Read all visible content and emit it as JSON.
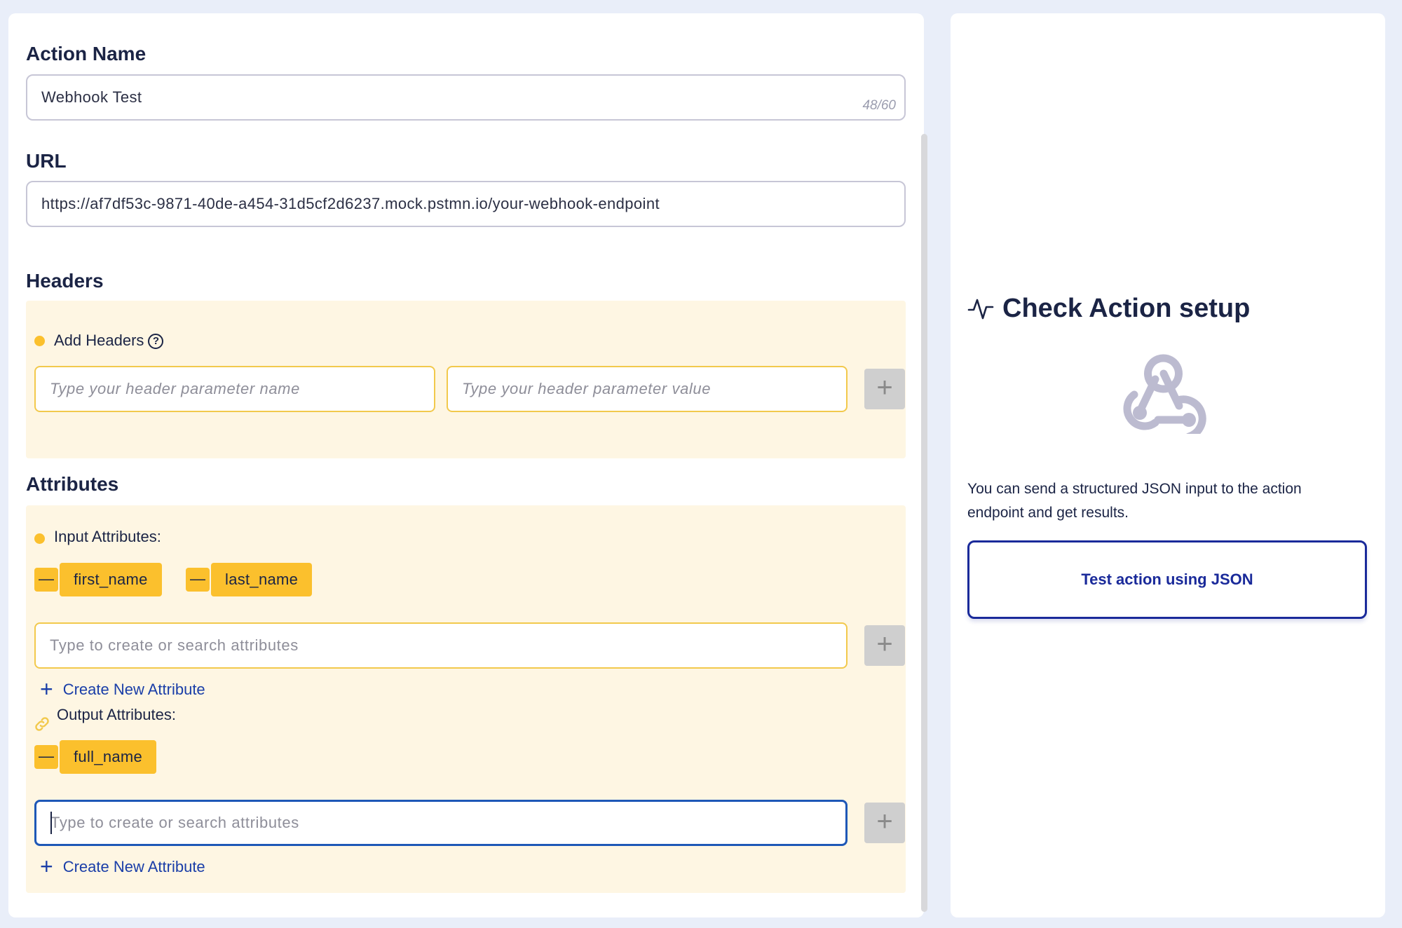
{
  "form": {
    "action_name": {
      "label": "Action Name",
      "value": "Webhook Test",
      "counter": "48/60"
    },
    "url": {
      "label": "URL",
      "value": "https://af7df53c-9871-40de-a454-31d5cf2d6237.mock.pstmn.io/your-webhook-endpoint"
    },
    "headers": {
      "label": "Headers",
      "add_label": "Add Headers",
      "help_icon": "question-circle-icon",
      "name_placeholder": "Type your header parameter name",
      "value_placeholder": "Type your header parameter value",
      "add_button": "+"
    },
    "attributes": {
      "label": "Attributes",
      "input_label": "Input Attributes:",
      "input_chips": [
        "first_name",
        "last_name"
      ],
      "input_placeholder": "Type to create or search attributes",
      "create_new": "Create New Attribute",
      "output_label": "Output Attributes:",
      "output_icon": "link-icon",
      "output_chips": [
        "full_name"
      ],
      "output_placeholder": "Type to create or search attributes",
      "create_new_output": "Create New Attribute",
      "remove_symbol": "—",
      "add_button": "+"
    }
  },
  "check_panel": {
    "title": "Check Action setup",
    "title_icon": "activity-pulse-icon",
    "illustration": "webhook-icon",
    "description": "You can send a structured JSON input to the action endpoint and get results.",
    "test_button": "Test action using JSON"
  },
  "colors": {
    "background": "#e9eef9",
    "accent_yellow": "#fbc02d",
    "yellow_panel": "#fef6e3",
    "primary_blue": "#1a2a9a",
    "link_blue": "#1a3ea8",
    "text_dark": "#1b2445"
  }
}
